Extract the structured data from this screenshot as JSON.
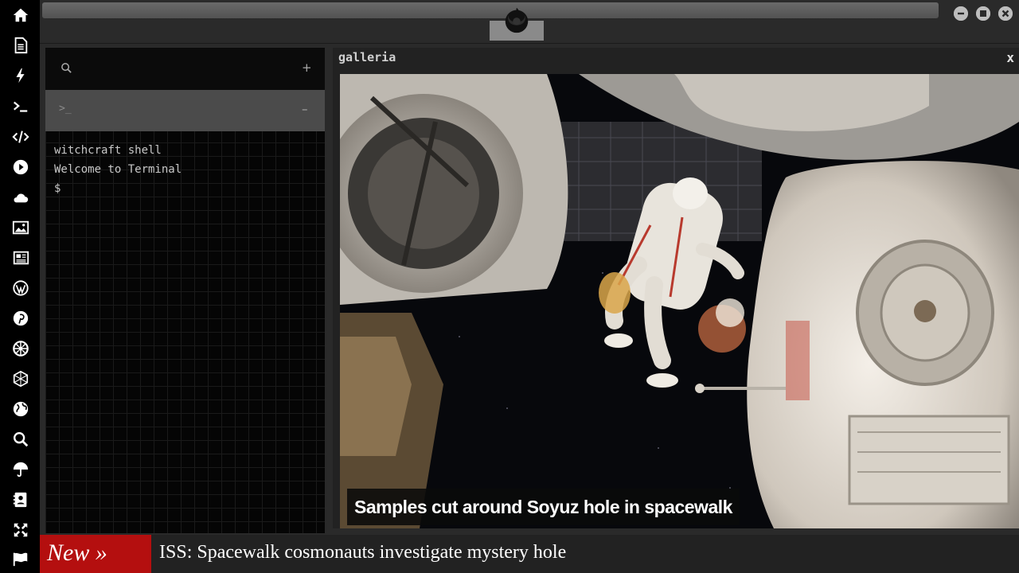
{
  "sidebar": {
    "icons": [
      "home-icon",
      "document-icon",
      "bolt-icon",
      "terminal-icon",
      "code-icon",
      "play-icon",
      "cloud-icon",
      "image-icon",
      "newspaper-icon",
      "wordpress-icon",
      "pinterest-icon",
      "empire-icon",
      "network-icon",
      "globe-icon",
      "search-icon",
      "umbrella-icon",
      "contacts-icon",
      "expand-icon",
      "flag-icon"
    ]
  },
  "topbar": {
    "logo_icon": "rebel-alliance-icon",
    "window_buttons": [
      "minimize-icon",
      "maximize-icon",
      "close-icon"
    ]
  },
  "terminal": {
    "search_icon": "search-icon",
    "add_label": "+",
    "prompt_icon": ">_",
    "collapse_label": "–",
    "lines": [
      "witchcraft shell",
      "Welcome to Terminal",
      "$"
    ]
  },
  "gallery": {
    "title": "galleria",
    "close_label": "x",
    "caption": "Samples cut around Soyuz hole in spacewalk"
  },
  "ticker": {
    "badge": "New »",
    "headline": "ISS: Spacewalk cosmonauts investigate mystery hole"
  }
}
